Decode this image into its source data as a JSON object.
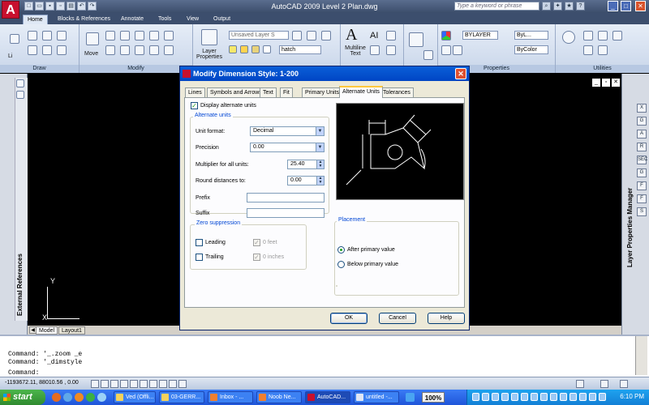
{
  "app": {
    "logo_letter": "A",
    "title": "AutoCAD 2009  Level 2 Plan.dwg",
    "help_search_placeholder": "Type a keyword or phrase"
  },
  "ribbon": {
    "tabs": [
      {
        "label": "Home"
      },
      {
        "label": "Blocks & References"
      },
      {
        "label": "Annotate"
      },
      {
        "label": "Tools"
      },
      {
        "label": "View"
      },
      {
        "label": "Output"
      }
    ],
    "panels": {
      "draw": "Draw",
      "modify": "Modify",
      "properties": "Properties",
      "utilities": "Utilities"
    },
    "move_label": "Move",
    "layer_properties_label": "Layer Properties",
    "layer_combo": "Unsaved Layer S",
    "layer_current": "hatch",
    "multiline_text_label": "Multiline Text",
    "color_combo": "BYLAYER",
    "linetype_combo": "ByL...",
    "lineweight_combo": "ByColor",
    "line_label": "Li"
  },
  "drawing": {
    "ucs_x": "X",
    "ucs_y": "Y",
    "left_palette_title": "External References",
    "right_palette_title": "Layer Properties Manager",
    "right_palette_icons": [
      "X",
      "G",
      "A",
      "R",
      "SEC",
      "G",
      "F",
      "F",
      "S"
    ],
    "layout_tabs": [
      "Model",
      "Layout1"
    ]
  },
  "command": {
    "lines": [
      "Command: '_.zoom _e",
      "Command: '_dimstyle",
      "Command:"
    ],
    "coordinates": "-1193672.11, 88010.56 , 0.00"
  },
  "dialog": {
    "title": "Modify Dimension Style: 1-200",
    "tabs": [
      "Lines",
      "Symbols and Arrows",
      "Text",
      "Fit",
      "Primary Units",
      "Alternate Units",
      "Tolerances"
    ],
    "active_tab": "Alternate Units",
    "display_alt_units_label": "Display alternate units",
    "display_alt_units_checked": true,
    "alternate_units_group": "Alternate units",
    "unit_format_label": "Unit format:",
    "unit_format_value": "Decimal",
    "precision_label": "Precision",
    "precision_value": "0.00",
    "multiplier_label": "Multiplier for all units:",
    "multiplier_value": "25.40",
    "round_label": "Round distances  to:",
    "round_value": "0.00",
    "prefix_label": "Prefix",
    "prefix_value": "",
    "suffix_label": "Suffix",
    "suffix_value": "",
    "zero_suppression_group": "Zero suppression",
    "leading_label": "Leading",
    "trailing_label": "Trailing",
    "zero_feet_label": "0 feet",
    "zero_inches_label": "0 inches",
    "placement_group": "Placement",
    "after_primary_label": "After primary value",
    "below_primary_label": "Below primary value",
    "placement_selected": "After primary value",
    "ok_label": "OK",
    "cancel_label": "Cancel",
    "help_label": "Help"
  },
  "taskbar": {
    "start_label": "start",
    "tasks": [
      "Ved (Offli...",
      "03-GERR...",
      "Inbox - ...",
      "Noob Ne...",
      "AutoCAD...",
      "untitled -..."
    ],
    "battery": "100%",
    "clock": "6:10 PM"
  }
}
